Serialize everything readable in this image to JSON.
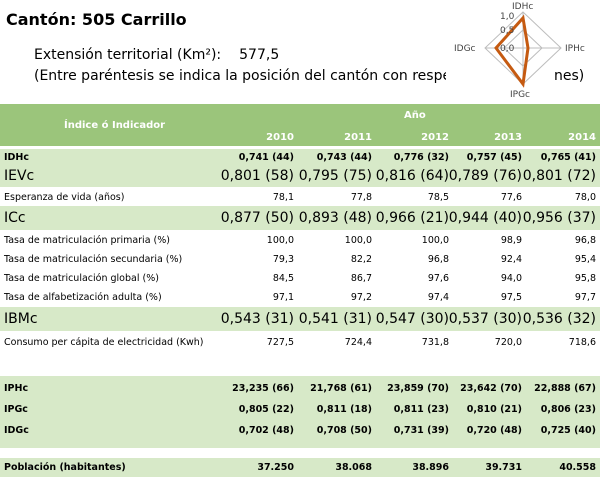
{
  "title": "Cantón: 505 Carrillo",
  "extension": {
    "label": "Extensión territorial (Km²):",
    "value": "577,5"
  },
  "note": "(Entre paréntesis se indica la posición del cantón con respecto al to",
  "note_tail": "nes)",
  "radar": {
    "ticks": [
      "1,0",
      "0,5",
      "0,0"
    ],
    "labels": [
      "IDHc",
      "IPHc",
      "IPGc",
      "IDGc"
    ]
  },
  "table": {
    "header_label": "Índice ó Indicador",
    "year_label": "Año",
    "years": [
      "2010",
      "2011",
      "2012",
      "2013",
      "2014"
    ],
    "rows": [
      {
        "label": "IDHc",
        "values": [
          "0,741 (44)",
          "0,743 (44)",
          "0,776 (32)",
          "0,757 (45)",
          "0,765 (41)"
        ]
      },
      {
        "label": "IEVc",
        "values": [
          "0,801 (58)",
          "0,795 (75)",
          "0,816 (64)",
          "0,789 (76)",
          "0,801 (72)"
        ]
      },
      {
        "label": "Esperanza de vida (años)",
        "values": [
          "78,1",
          "77,8",
          "78,5",
          "77,6",
          "78,0"
        ]
      },
      {
        "label": "ICc",
        "values": [
          "0,877 (50)",
          "0,893 (48)",
          "0,966 (21)",
          "0,944 (40)",
          "0,956 (37)"
        ]
      },
      {
        "label": "Tasa de matriculación primaria (%)",
        "values": [
          "100,0",
          "100,0",
          "100,0",
          "98,9",
          "96,8"
        ]
      },
      {
        "label": "Tasa de matriculación secundaria (%)",
        "values": [
          "79,3",
          "82,2",
          "96,8",
          "92,4",
          "95,4"
        ]
      },
      {
        "label": "Tasa de matriculación global (%)",
        "values": [
          "84,5",
          "86,7",
          "97,6",
          "94,0",
          "95,8"
        ]
      },
      {
        "label": "Tasa de alfabetización adulta (%)",
        "values": [
          "97,1",
          "97,2",
          "97,4",
          "97,5",
          "97,7"
        ]
      },
      {
        "label": "IBMc",
        "values": [
          "0,543 (31)",
          "0,541 (31)",
          "0,547 (30)",
          "0,537 (30)",
          "0,536 (32)"
        ]
      },
      {
        "label": "Consumo per cápita de electricidad (Kwh)",
        "values": [
          "727,5",
          "724,4",
          "731,8",
          "720,0",
          "718,6"
        ]
      },
      {
        "label": "IPHc",
        "values": [
          "23,235 (66)",
          "21,768 (61)",
          "23,859 (70)",
          "23,642 (70)",
          "22,888 (67)"
        ]
      },
      {
        "label": "IPGc",
        "values": [
          "0,805 (22)",
          "0,811 (18)",
          "0,811 (23)",
          "0,810 (21)",
          "0,806 (23)"
        ]
      },
      {
        "label": "IDGc",
        "values": [
          "0,702 (48)",
          "0,708 (50)",
          "0,731 (39)",
          "0,720 (48)",
          "0,725 (40)"
        ]
      },
      {
        "label": "Población (habitantes)",
        "values": [
          "37.250",
          "38.068",
          "38.896",
          "39.731",
          "40.558"
        ]
      }
    ]
  }
}
